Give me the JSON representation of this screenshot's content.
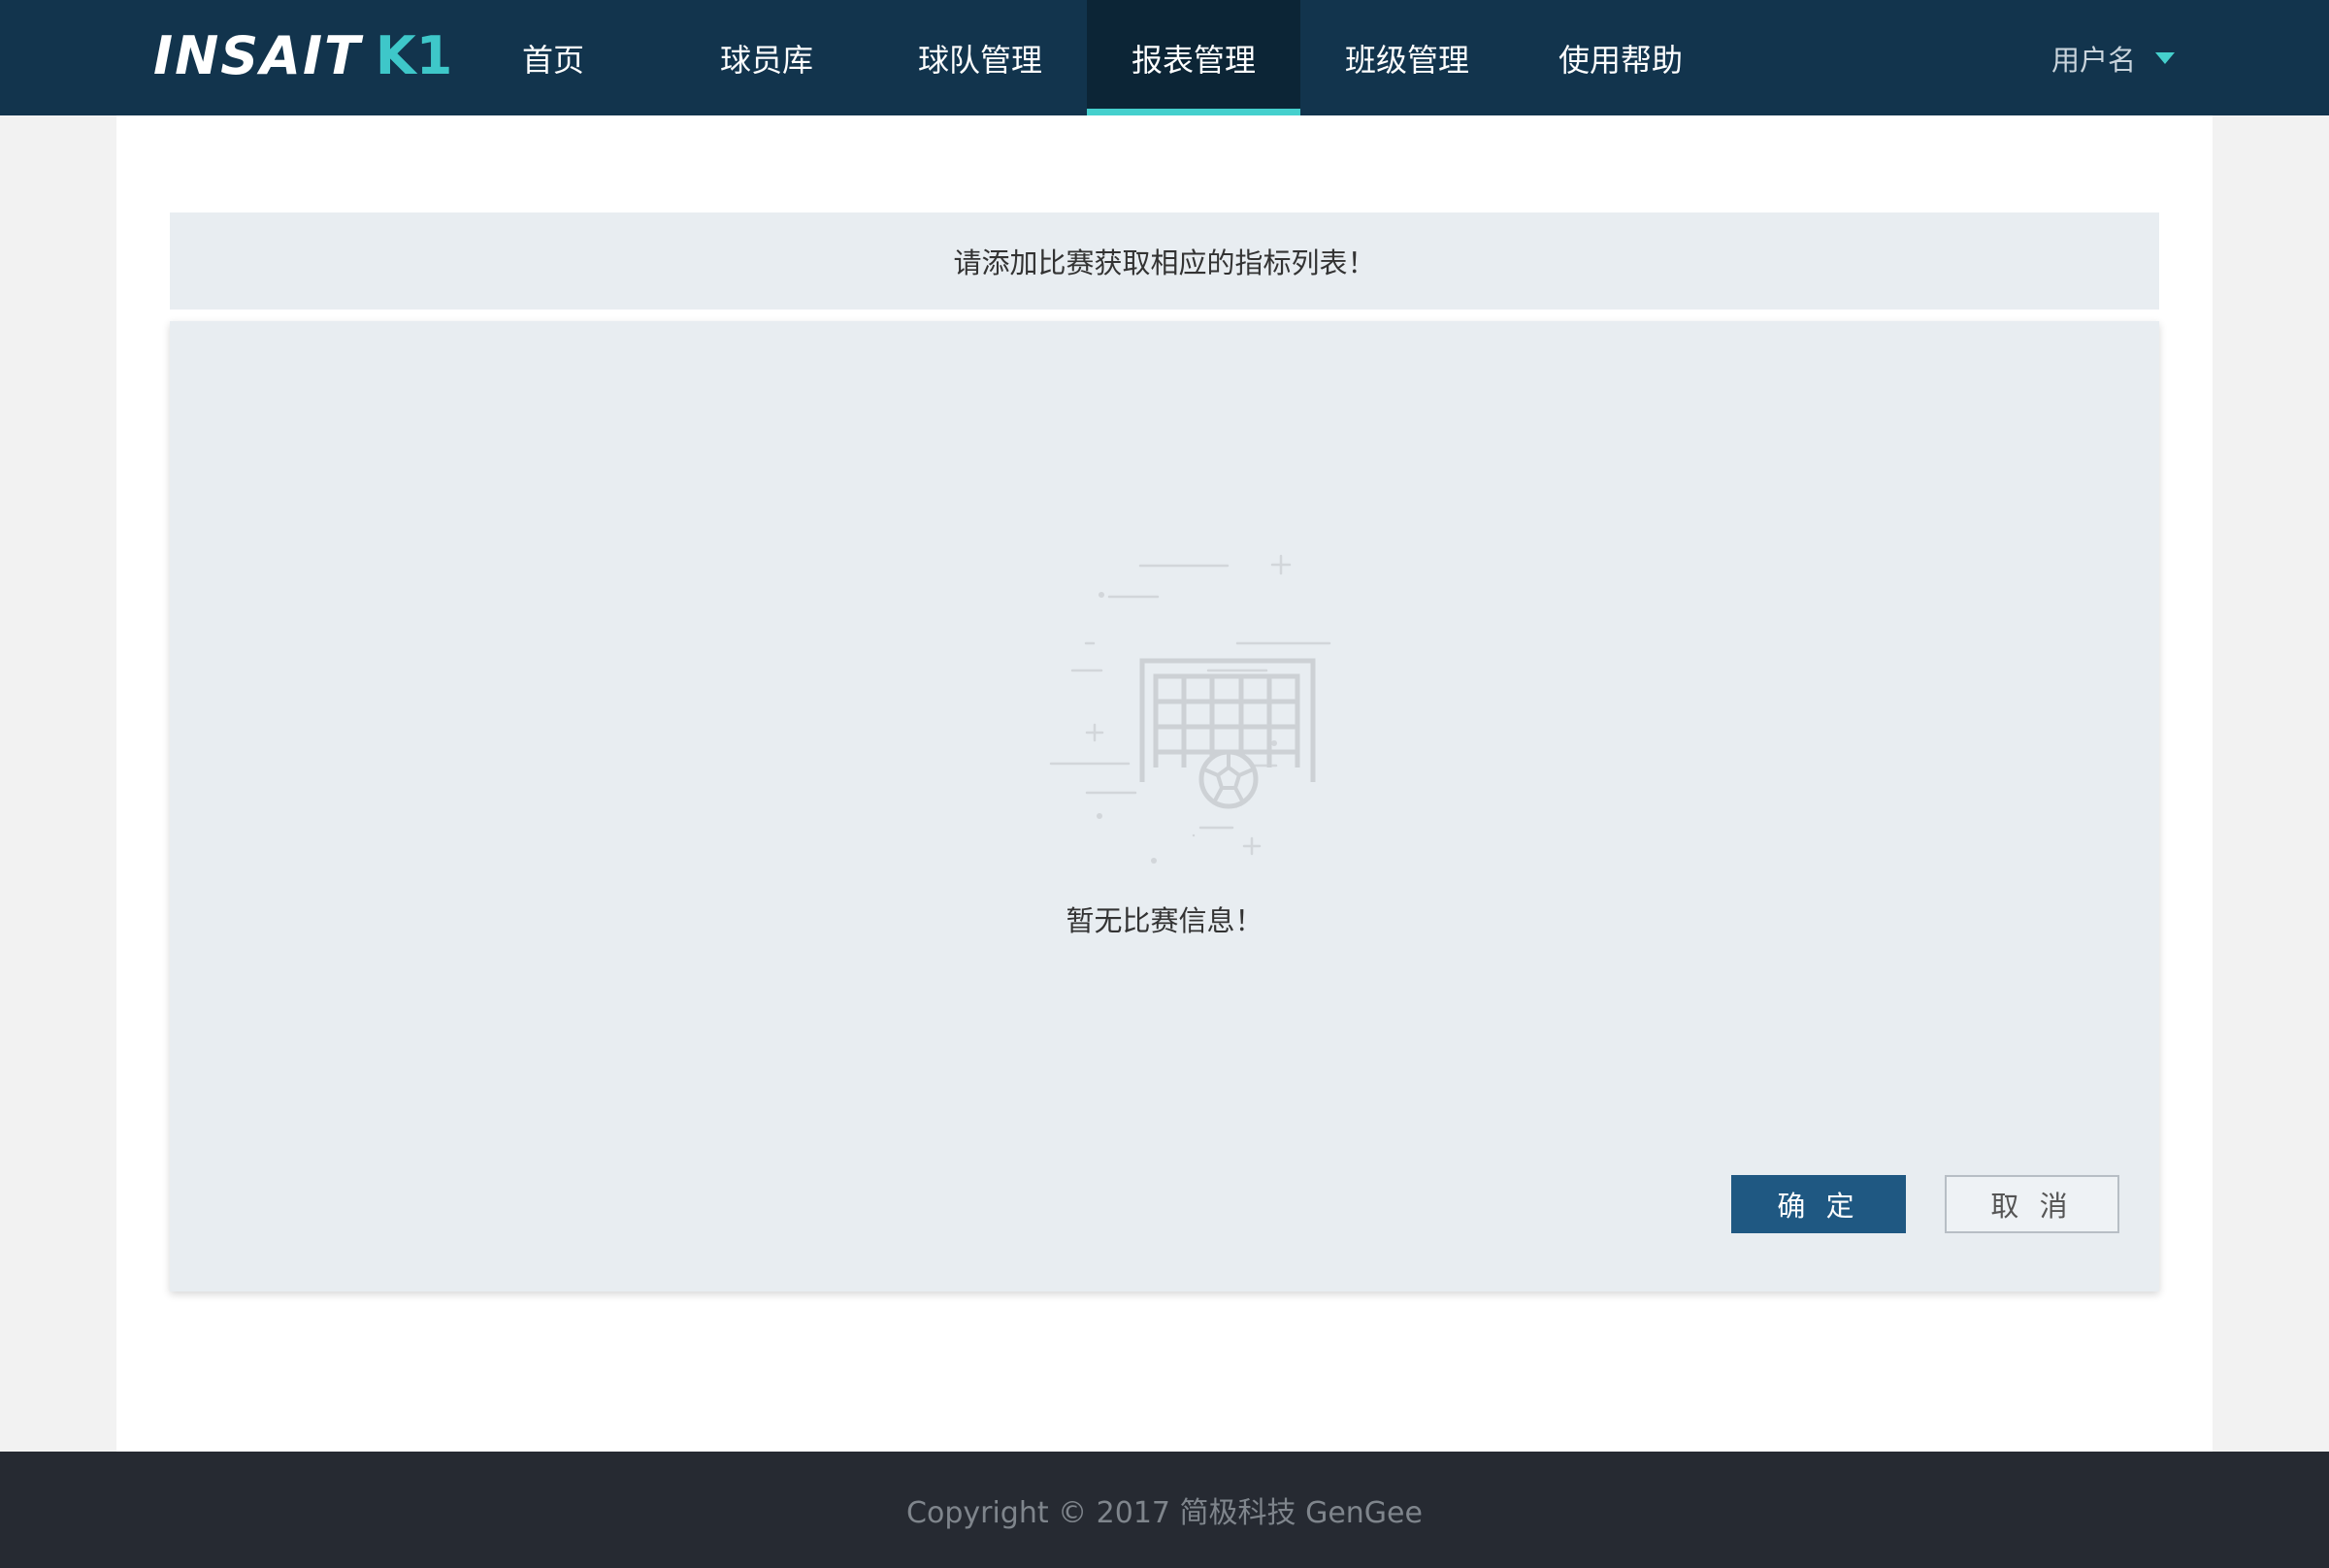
{
  "header": {
    "logo": {
      "brand": "INSAIT",
      "model": "K1"
    },
    "nav": [
      {
        "label": "首页",
        "active": false
      },
      {
        "label": "球员库",
        "active": false
      },
      {
        "label": "球队管理",
        "active": false
      },
      {
        "label": "报表管理",
        "active": true
      },
      {
        "label": "班级管理",
        "active": false
      },
      {
        "label": "使用帮助",
        "active": false
      }
    ],
    "user_label": "用户名"
  },
  "main": {
    "notice": "请添加比赛获取相应的指标列表！",
    "empty_state": {
      "icon": "soccer-goal-icon",
      "text": "暂无比赛信息！"
    },
    "buttons": {
      "confirm": "确 定",
      "cancel": "取 消"
    }
  },
  "footer": {
    "copyright": "Copyright © 2017 简极科技 GenGee"
  },
  "colors": {
    "header_bg": "#12344d",
    "accent": "#45d0cd",
    "primary_button": "#1f5882",
    "panel_bg": "#e8edf1",
    "footer_bg": "#262a32"
  }
}
